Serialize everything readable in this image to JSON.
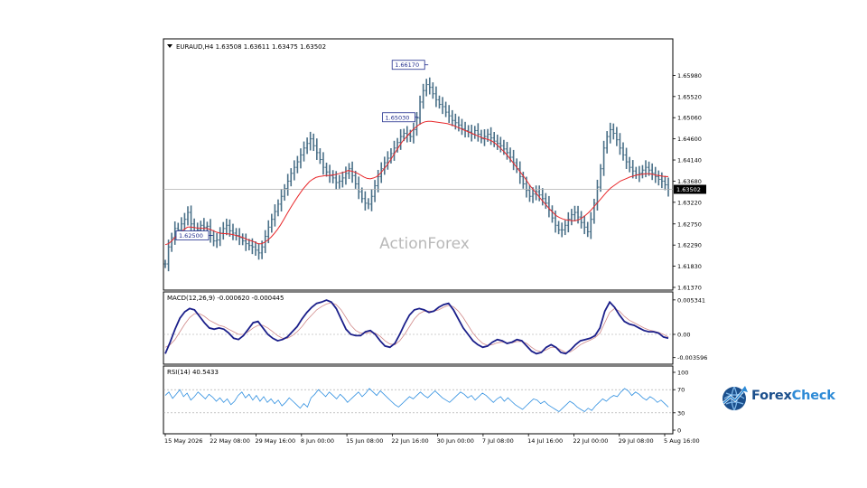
{
  "chart_data": [
    {
      "type": "candlestick",
      "header": "EURAUD,H4  1.63508 1.63611 1.63475 1.63502",
      "watermark": "ActionForex",
      "ylim": [
        1.6137,
        1.6644
      ],
      "yticks": [
        "1.65980",
        "1.65520",
        "1.65060",
        "1.64600",
        "1.64140",
        "1.63680",
        "1.63220",
        "1.62750",
        "1.62290",
        "1.61830",
        "1.61370"
      ],
      "current_price_label": "1.63502",
      "current_price": 1.63502,
      "annotations": [
        {
          "text": "1.66170",
          "value": 1.6617,
          "kind": "high"
        },
        {
          "text": "1.65030",
          "value": 1.6503,
          "kind": "high"
        },
        {
          "text": "1.62500",
          "value": 1.625,
          "kind": "low"
        }
      ],
      "ma_color": "#e8282b",
      "bar_color": "#4a7088",
      "close_series": [
        1.6188,
        1.6225,
        1.6245,
        1.6265,
        1.6262,
        1.6275,
        1.6285,
        1.63,
        1.6275,
        1.626,
        1.6262,
        1.6272,
        1.6268,
        1.627,
        1.625,
        1.6238,
        1.624,
        1.6255,
        1.6265,
        1.6272,
        1.626,
        1.6255,
        1.625,
        1.6245,
        1.6238,
        1.6232,
        1.6228,
        1.6225,
        1.6218,
        1.6212,
        1.6225,
        1.6248,
        1.6268,
        1.6285,
        1.6302,
        1.6318,
        1.6335,
        1.6352,
        1.6368,
        1.6385,
        1.6398,
        1.641,
        1.6425,
        1.644,
        1.645,
        1.646,
        1.6445,
        1.643,
        1.6415,
        1.6398,
        1.6388,
        1.638,
        1.6375,
        1.6365,
        1.6368,
        1.6375,
        1.6385,
        1.6395,
        1.638,
        1.6362,
        1.6345,
        1.633,
        1.632,
        1.6318,
        1.6335,
        1.6358,
        1.6378,
        1.6395,
        1.6408,
        1.6418,
        1.6428,
        1.644,
        1.6452,
        1.6465,
        1.6472,
        1.6468,
        1.6465,
        1.648,
        1.6505,
        1.654,
        1.6565,
        1.6578,
        1.6572,
        1.6558,
        1.6545,
        1.6535,
        1.653,
        1.6518,
        1.651,
        1.65,
        1.6495,
        1.649,
        1.6482,
        1.6478,
        1.6475,
        1.647,
        1.6478,
        1.647,
        1.646,
        1.6465,
        1.647,
        1.6462,
        1.6455,
        1.645,
        1.6445,
        1.6438,
        1.643,
        1.642,
        1.6408,
        1.6395,
        1.6378,
        1.6362,
        1.6348,
        1.6335,
        1.634,
        1.6345,
        1.6338,
        1.633,
        1.632,
        1.6305,
        1.6288,
        1.6272,
        1.6262,
        1.6262,
        1.6272,
        1.6285,
        1.6295,
        1.63,
        1.629,
        1.6278,
        1.6268,
        1.6258,
        1.6285,
        1.632,
        1.6355,
        1.6395,
        1.644,
        1.6465,
        1.648,
        1.6472,
        1.6458,
        1.644,
        1.6425,
        1.641,
        1.6398,
        1.639,
        1.6382,
        1.6385,
        1.6392,
        1.6398,
        1.6392,
        1.6385,
        1.6378,
        1.6372,
        1.6368,
        1.636,
        1.63502
      ],
      "ma_series": [
        1.623,
        1.6232,
        1.6238,
        1.6245,
        1.6252,
        1.6258,
        1.6264,
        1.6268,
        1.6268,
        1.6267,
        1.6266,
        1.6266,
        1.6265,
        1.6265,
        1.6263,
        1.626,
        1.6257,
        1.6255,
        1.6254,
        1.6254,
        1.6253,
        1.6252,
        1.625,
        1.6248,
        1.6246,
        1.6243,
        1.624,
        1.6238,
        1.6235,
        1.6232,
        1.6232,
        1.6235,
        1.624,
        1.6246,
        1.6254,
        1.6263,
        1.6273,
        1.6285,
        1.6297,
        1.6309,
        1.632,
        1.6331,
        1.6341,
        1.6351,
        1.6359,
        1.6367,
        1.6372,
        1.6376,
        1.6378,
        1.6379,
        1.638,
        1.638,
        1.6381,
        1.6382,
        1.6384,
        1.6386,
        1.6388,
        1.6391,
        1.639,
        1.6388,
        1.6385,
        1.6381,
        1.6377,
        1.6374,
        1.6373,
        1.6375,
        1.6378,
        1.6384,
        1.6392,
        1.6401,
        1.6411,
        1.6422,
        1.6433,
        1.6444,
        1.6454,
        1.6462,
        1.647,
        1.6478,
        1.6484,
        1.649,
        1.6494,
        1.6497,
        1.6498,
        1.6498,
        1.6497,
        1.6496,
        1.6495,
        1.6494,
        1.6493,
        1.6491,
        1.6489,
        1.6486,
        1.6483,
        1.648,
        1.6477,
        1.6474,
        1.6471,
        1.6468,
        1.6465,
        1.6462,
        1.646,
        1.6458,
        1.6455,
        1.645,
        1.6444,
        1.6437,
        1.643,
        1.6422,
        1.6413,
        1.6404,
        1.6395,
        1.6386,
        1.6377,
        1.6367,
        1.6357,
        1.6348,
        1.634,
        1.6331,
        1.6323,
        1.6315,
        1.6307,
        1.63,
        1.6293,
        1.6289,
        1.6286,
        1.6284,
        1.6283,
        1.6282,
        1.6282,
        1.6284,
        1.6288,
        1.6293,
        1.6299,
        1.6306,
        1.6314,
        1.6322,
        1.633,
        1.6338,
        1.6346,
        1.6353,
        1.6358,
        1.6363,
        1.6368,
        1.6371,
        1.6374,
        1.6377,
        1.6379,
        1.6381,
        1.6382,
        1.6383,
        1.6384,
        1.6384,
        1.6383,
        1.6381,
        1.638,
        1.6379,
        1.6378,
        1.6378
      ]
    },
    {
      "type": "line",
      "label": "MACD(12,26,9) -0.000620 -0.000445",
      "yticks": [
        "0.005341",
        "0.00",
        "-0.003596"
      ],
      "ylim": [
        -0.0042,
        0.0056
      ],
      "line_colors": {
        "macd": "#1b1f8a",
        "signal": "#d08a8a"
      },
      "macd": [
        -0.003,
        -0.0012,
        0.0008,
        0.0025,
        0.0035,
        0.004,
        0.0038,
        0.0028,
        0.0018,
        0.001,
        0.0008,
        0.001,
        0.0008,
        0.0002,
        -0.0006,
        -0.0008,
        -0.0002,
        0.0008,
        0.0018,
        0.002,
        0.001,
        0.0,
        -0.0006,
        -0.001,
        -0.0008,
        -0.0004,
        0.0004,
        0.0012,
        0.0024,
        0.0034,
        0.0042,
        0.0048,
        0.005,
        0.0053,
        0.005,
        0.004,
        0.0024,
        0.0008,
        0.0,
        -0.0002,
        -0.0002,
        0.0004,
        0.0006,
        0.0,
        -0.001,
        -0.0018,
        -0.002,
        -0.0014,
        0.0,
        0.0016,
        0.003,
        0.0038,
        0.004,
        0.0038,
        0.0034,
        0.0036,
        0.0042,
        0.0046,
        0.0048,
        0.0038,
        0.0024,
        0.001,
        0.0,
        -0.001,
        -0.0016,
        -0.002,
        -0.0018,
        -0.0012,
        -0.0008,
        -0.001,
        -0.0014,
        -0.0012,
        -0.0008,
        -0.001,
        -0.0018,
        -0.0026,
        -0.003,
        -0.0028,
        -0.002,
        -0.0016,
        -0.002,
        -0.0028,
        -0.003,
        -0.0024,
        -0.0016,
        -0.001,
        -0.0008,
        -0.0006,
        -0.0002,
        0.001,
        0.0036,
        0.005,
        0.0042,
        0.003,
        0.002,
        0.0016,
        0.0014,
        0.001,
        0.0006,
        0.0004,
        0.0004,
        0.0002,
        -0.0004,
        -0.0006
      ],
      "signal": [
        -0.002,
        -0.0016,
        -0.0008,
        0.0004,
        0.0016,
        0.0026,
        0.0032,
        0.0032,
        0.0028,
        0.0022,
        0.0018,
        0.0014,
        0.0012,
        0.0008,
        0.0004,
        0.0,
        0.0,
        0.0004,
        0.001,
        0.0014,
        0.0014,
        0.001,
        0.0004,
        -0.0002,
        -0.0006,
        -0.0006,
        -0.0002,
        0.0004,
        0.0012,
        0.0022,
        0.003,
        0.0038,
        0.0043,
        0.0047,
        0.0049,
        0.0046,
        0.0038,
        0.0026,
        0.0014,
        0.0006,
        0.0002,
        0.0002,
        0.0003,
        0.0002,
        -0.0003,
        -0.001,
        -0.0015,
        -0.0016,
        -0.001,
        0.0,
        0.0012,
        0.0024,
        0.0032,
        0.0036,
        0.0036,
        0.0036,
        0.0038,
        0.0042,
        0.0045,
        0.0043,
        0.0036,
        0.0026,
        0.0014,
        0.0002,
        -0.0007,
        -0.0014,
        -0.0017,
        -0.0016,
        -0.0013,
        -0.0012,
        -0.0013,
        -0.0013,
        -0.0011,
        -0.0011,
        -0.0014,
        -0.002,
        -0.0025,
        -0.0027,
        -0.0024,
        -0.002,
        -0.002,
        -0.0024,
        -0.0028,
        -0.0027,
        -0.0022,
        -0.0016,
        -0.0012,
        -0.0009,
        -0.0005,
        0.0002,
        0.0018,
        0.0034,
        0.004,
        0.0036,
        0.0028,
        0.0022,
        0.0018,
        0.0014,
        0.001,
        0.0007,
        0.0005,
        0.0003,
        0.0,
        -0.0004
      ]
    },
    {
      "type": "line",
      "label": "RSI(14) 40.5433",
      "yticks": [
        "100",
        "70",
        "30",
        "0"
      ],
      "ylim": [
        0,
        100
      ],
      "line_color": "#2f8fe0",
      "rsi": [
        60,
        66,
        55,
        62,
        70,
        58,
        64,
        52,
        58,
        66,
        60,
        54,
        62,
        57,
        50,
        56,
        48,
        54,
        44,
        50,
        60,
        66,
        56,
        62,
        52,
        60,
        50,
        58,
        48,
        54,
        46,
        52,
        42,
        48,
        56,
        50,
        44,
        38,
        46,
        40,
        56,
        62,
        70,
        64,
        58,
        66,
        60,
        54,
        62,
        56,
        48,
        54,
        60,
        66,
        58,
        64,
        72,
        66,
        60,
        68,
        62,
        56,
        50,
        44,
        40,
        46,
        52,
        58,
        54,
        60,
        66,
        60,
        56,
        62,
        68,
        62,
        56,
        52,
        48,
        54,
        60,
        66,
        62,
        56,
        60,
        52,
        58,
        64,
        60,
        54,
        48,
        54,
        58,
        50,
        56,
        50,
        44,
        40,
        36,
        42,
        48,
        54,
        52,
        46,
        50,
        44,
        40,
        36,
        32,
        38,
        44,
        50,
        46,
        40,
        36,
        32,
        38,
        34,
        42,
        48,
        54,
        50,
        56,
        60,
        58,
        66,
        72,
        68,
        60,
        66,
        62,
        56,
        52,
        58,
        54,
        48,
        52,
        46,
        40
      ],
      "levels": [
        70,
        30
      ]
    }
  ],
  "time_axis": [
    "15 May 2026",
    "22 May 08:00",
    "29 May 16:00",
    "8 Jun 00:00",
    "15 Jun 08:00",
    "22 Jun 16:00",
    "30 Jun 00:00",
    "7 Jul 08:00",
    "14 Jul 16:00",
    "22 Jul 00:00",
    "29 Jul 08:00",
    "5 Aug 16:00"
  ],
  "brand": {
    "name_a": "Forex",
    "name_b": "Check",
    "color_a": "#1b4f8c",
    "color_b": "#2d8ad6"
  }
}
